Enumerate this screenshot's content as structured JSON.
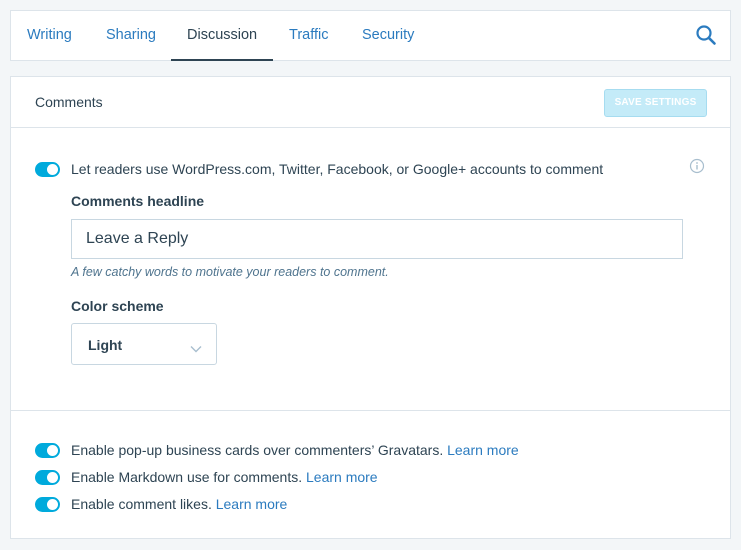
{
  "tabs": [
    {
      "label": "Writing"
    },
    {
      "label": "Sharing"
    },
    {
      "label": "Discussion"
    },
    {
      "label": "Traffic"
    },
    {
      "label": "Security"
    }
  ],
  "active_tab": "Discussion",
  "comments_card": {
    "title": "Comments",
    "save_label": "SAVE SETTINGS",
    "social_toggle": {
      "label": "Let readers use WordPress.com, Twitter, Facebook, or Google+ accounts to comment",
      "enabled": true
    },
    "headline": {
      "label": "Comments headline",
      "value": "Leave a Reply",
      "hint": "A few catchy words to motivate your readers to comment."
    },
    "color_scheme": {
      "label": "Color scheme",
      "value": "Light"
    },
    "options": [
      {
        "label": "Enable pop-up business cards over commenters’ Gravatars.",
        "link": "Learn more",
        "enabled": true
      },
      {
        "label": "Enable Markdown use for comments.",
        "link": "Learn more",
        "enabled": true
      },
      {
        "label": "Enable comment likes.",
        "link": "Learn more",
        "enabled": true
      }
    ]
  },
  "colors": {
    "accent": "#00aadc",
    "link": "#2b7bbf",
    "text": "#2e4453",
    "save_disabled": "#c4ebf8"
  },
  "icons": {
    "search": "search-icon",
    "info": "info-icon",
    "chevron": "chevron-down-icon"
  }
}
